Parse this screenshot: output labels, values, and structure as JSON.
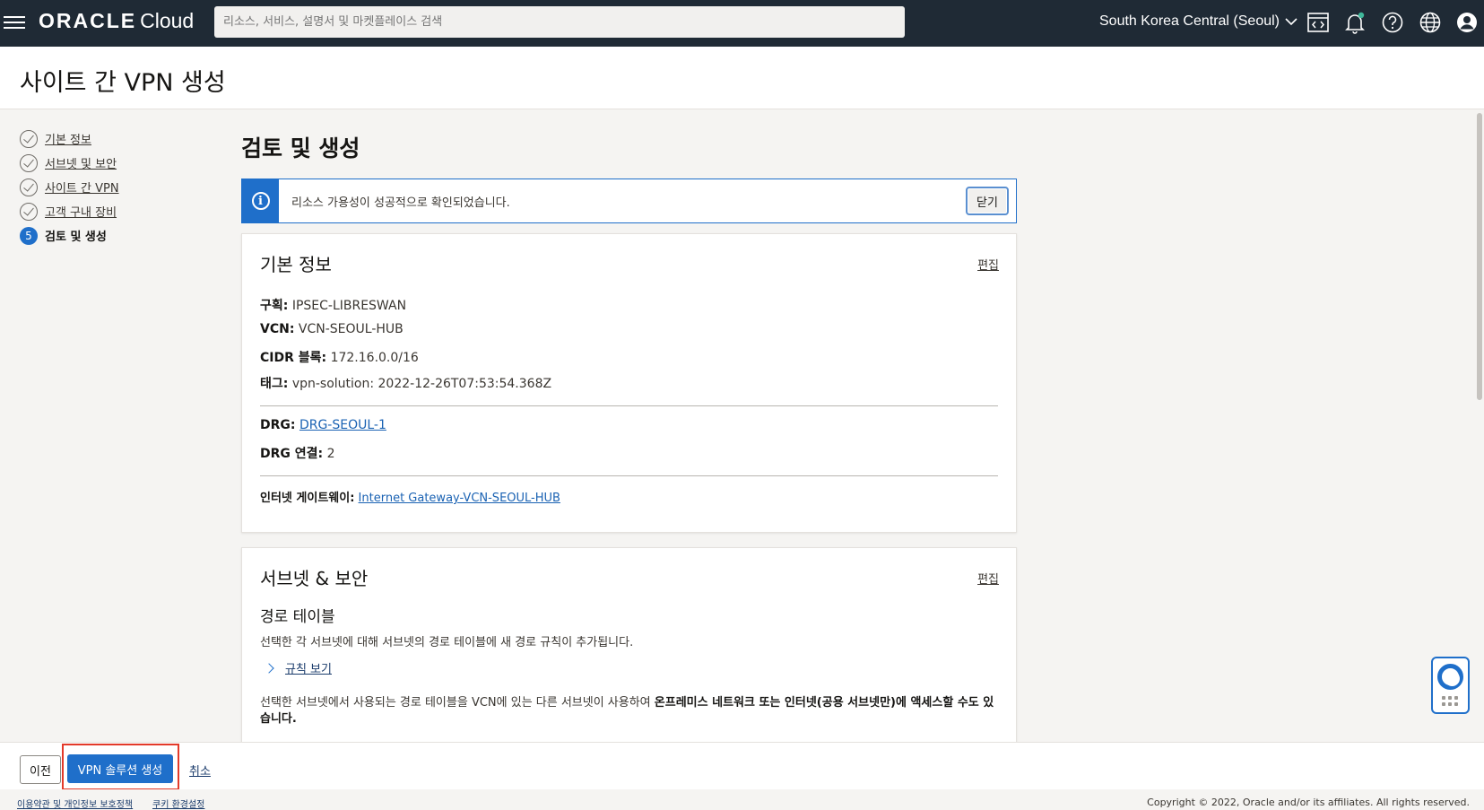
{
  "topbar": {
    "logo_oracle": "ORACLE",
    "logo_cloud": "Cloud",
    "search_placeholder": "리소스, 서비스, 설명서 및 마켓플레이스 검색",
    "region": "South Korea Central (Seoul)"
  },
  "page": {
    "title": "사이트 간 VPN 생성"
  },
  "steps": [
    {
      "label": "기본 정보"
    },
    {
      "label": "서브넷 및 보안"
    },
    {
      "label": "사이트 간 VPN"
    },
    {
      "label": "고객 구내 장비"
    },
    {
      "number": "5",
      "label": "검토 및 생성"
    }
  ],
  "main": {
    "title": "검토 및 생성",
    "banner": {
      "message": "리소스 가용성이 성공적으로 확인되었습니다.",
      "close_label": "닫기"
    },
    "basic": {
      "title": "기본 정보",
      "edit": "편집",
      "compartment_key": "구획:",
      "compartment_val": "IPSEC-LIBRESWAN",
      "vcn_key": "VCN:",
      "vcn_val": "VCN-SEOUL-HUB",
      "cidr_key": "CIDR 블록:",
      "cidr_val": "172.16.0.0/16",
      "tag_key": "태그:",
      "tag_val": "vpn-solution: 2022-12-26T07:53:54.368Z",
      "drg_key": "DRG:",
      "drg_val": "DRG-SEOUL-1",
      "drg_attach_key": "DRG 연결:",
      "drg_attach_val": "2",
      "igw_key": "인터넷 게이트웨이:",
      "igw_val": "Internet Gateway-VCN-SEOUL-HUB"
    },
    "subnet": {
      "title": "서브넷 & 보안",
      "edit": "편집",
      "route_title": "경로 테이블",
      "route_desc": "선택한 각 서브넷에 대해 서브넷의 경로 테이블에 새 경로 규칙이 추가됩니다.",
      "view_rules": "규칙 보기",
      "desc2_plain": "선택한 서브넷에서 사용되는 경로 테이블을 VCN에 있는 다른 서브넷이 사용하여 ",
      "desc2_bold": "온프레미스 네트워크 또는 인터넷(공용 서브넷만)에 액세스할 수도 있습니다."
    }
  },
  "bottom": {
    "prev": "이전",
    "create": "VPN 솔루션 생성",
    "cancel": "취소"
  },
  "footer": {
    "terms": "이용약관 및 개인정보 보호정책",
    "cookies": "쿠키 환경설정",
    "copyright": "Copyright © 2022, Oracle and/or its affiliates. All rights reserved."
  }
}
